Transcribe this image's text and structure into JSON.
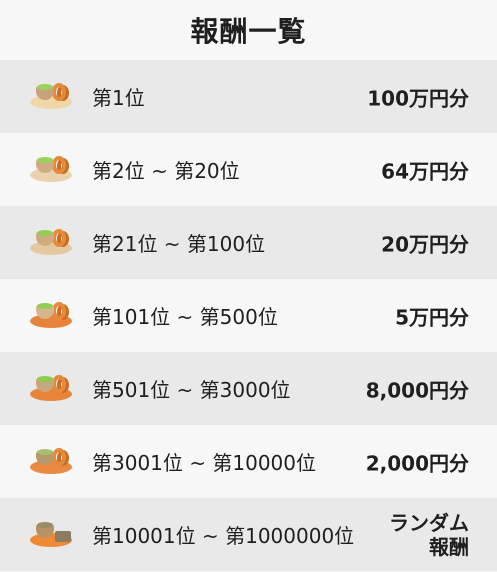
{
  "title": "報酬一覧",
  "colors": {
    "row_dark": "#e9e9e9",
    "row_light": "#f7f7f7",
    "text": "#1f1f1f",
    "matcha": "#8fcf54",
    "orange": "#e58a3a"
  },
  "rows": [
    {
      "rank": "第1位",
      "reward": "100万円分",
      "icon": "matcha-cup-donut-icon"
    },
    {
      "rank": "第2位 ~ 第20位",
      "reward": "64万円分",
      "icon": "matcha-cup-donut-icon"
    },
    {
      "rank": "第21位 ~ 第100位",
      "reward": "20万円分",
      "icon": "matcha-cup-donut-icon"
    },
    {
      "rank": "第101位 ~ 第500位",
      "reward": "5万円分",
      "icon": "matcha-cup-donut-icon"
    },
    {
      "rank": "第501位 ~ 第3000位",
      "reward": "8,000円分",
      "icon": "matcha-cup-donut-icon"
    },
    {
      "rank": "第3001位 ~ 第10000位",
      "reward": "2,000円分",
      "icon": "tea-cup-donut-icon"
    },
    {
      "rank": "第10001位 ~ 第1000000位",
      "reward_line1": "ランダム",
      "reward_line2": "報酬",
      "icon": "tea-cup-cake-icon"
    }
  ]
}
